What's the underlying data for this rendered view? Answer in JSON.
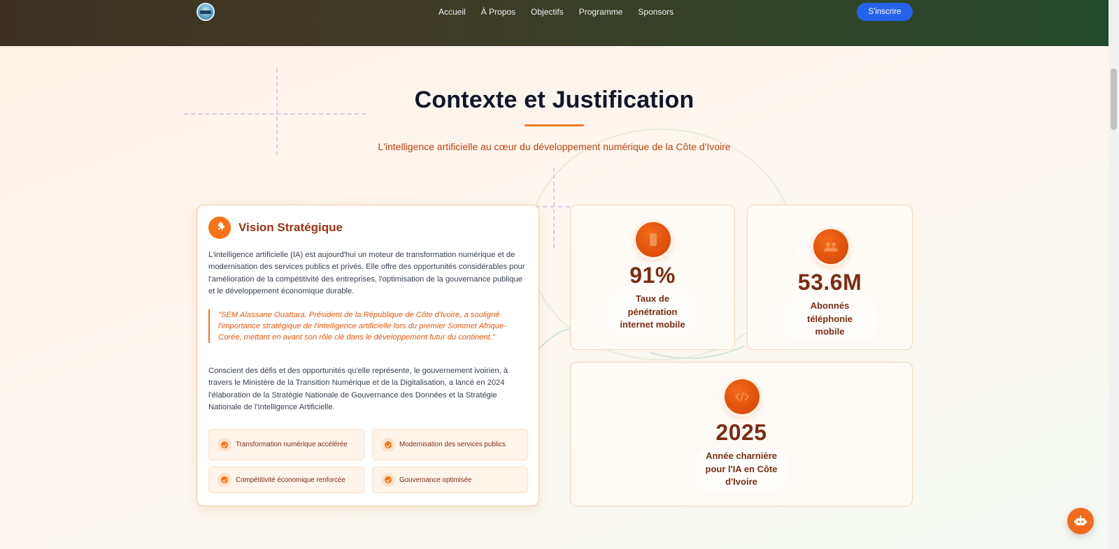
{
  "header": {
    "logo_icon": "event-logo",
    "nav": [
      "Accueil",
      "À Propos",
      "Objectifs",
      "Programme",
      "Sponsors"
    ],
    "signup_label": "S'inscrire"
  },
  "section": {
    "title": "Contexte et Justification",
    "subtitle": "L'intelligence artificielle au cœur du développement numérique de la Côte d'Ivoire"
  },
  "vision": {
    "icon": "puzzle-icon",
    "title": "Vision Stratégique",
    "paragraph1": "L'intelligence artificielle (IA) est aujourd'hui un moteur de transformation numérique et de modernisation des services publics et privés. Elle offre des opportunités considérables pour l'amélioration de la compétitivité des entreprises, l'optimisation de la gouvernance publique et le développement économique durable.",
    "quote": "\"SEM Alassane Ouattara, Président de la République de Côte d'Ivoire, a souligné l'importance stratégique de l'intelligence artificielle lors du premier Sommet Afrique-Corée, mettant en avant son rôle clé dans le développement futur du continent.\"",
    "paragraph2": "Conscient des défis et des opportunités qu'elle représente, le gouvernement ivoirien, à travers le Ministère de la Transition Numérique et de la Digitalisation, a lancé en 2024 l'élaboration de la Stratégie Nationale de Gouvernance des Données et la Stratégie Nationale de l'Intelligence Artificielle.",
    "chips": [
      "Transformation numérique accélérée",
      "Modernisation des services publics",
      "Compétitivité économique renforcée",
      "Gouvernance optimisée"
    ]
  },
  "stats": [
    {
      "icon": "mobile-icon",
      "value": "91%",
      "label": "Taux de pénétration internet mobile"
    },
    {
      "icon": "users-icon",
      "value": "53.6M",
      "label": "Abonnés téléphonie mobile"
    },
    {
      "icon": "code-icon",
      "value": "2025",
      "label": "Année charnière pour l'IA en Côte d'Ivoire"
    }
  ],
  "colors": {
    "accent": "#f97316",
    "accent_dark": "#7c2d12",
    "signup_button": "#2463eb"
  },
  "chatbot": {
    "icon": "robot-icon"
  }
}
